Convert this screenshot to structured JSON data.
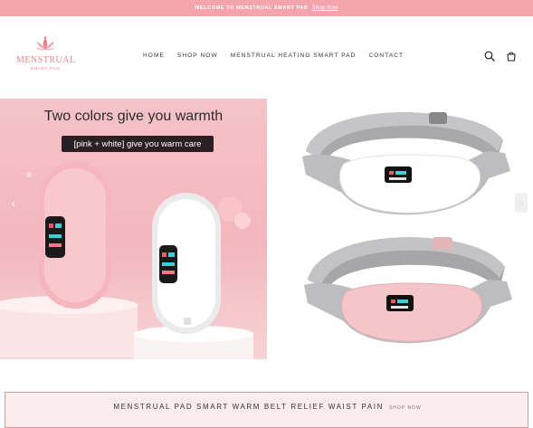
{
  "announcement": {
    "text": "WELCOME TO MENSTRUAL SMART PAD",
    "link": "Shop Now"
  },
  "brand": {
    "name": "MENSTRUAL",
    "sub": "SMART PAD",
    "color": "#e9838f"
  },
  "nav": {
    "items": [
      "HOME",
      "SHOP NOW",
      "MENSTRUAL HEATING SMART PAD",
      "CONTACT"
    ]
  },
  "header_icons": [
    "search-icon",
    "cart-icon"
  ],
  "hero": {
    "title": "Two colors give you warmth",
    "tag": "[pink + white] give you warm care",
    "prev_arrow": "‹",
    "next_arrow": "›"
  },
  "bottom": {
    "title": "MENSTRUAL PAD SMART WARM BELT RELIEF WAIST PAIN",
    "shop": "SHOP NOW"
  },
  "colors": {
    "announce_bg": "#f3a4ad",
    "accent": "#e9838f"
  }
}
